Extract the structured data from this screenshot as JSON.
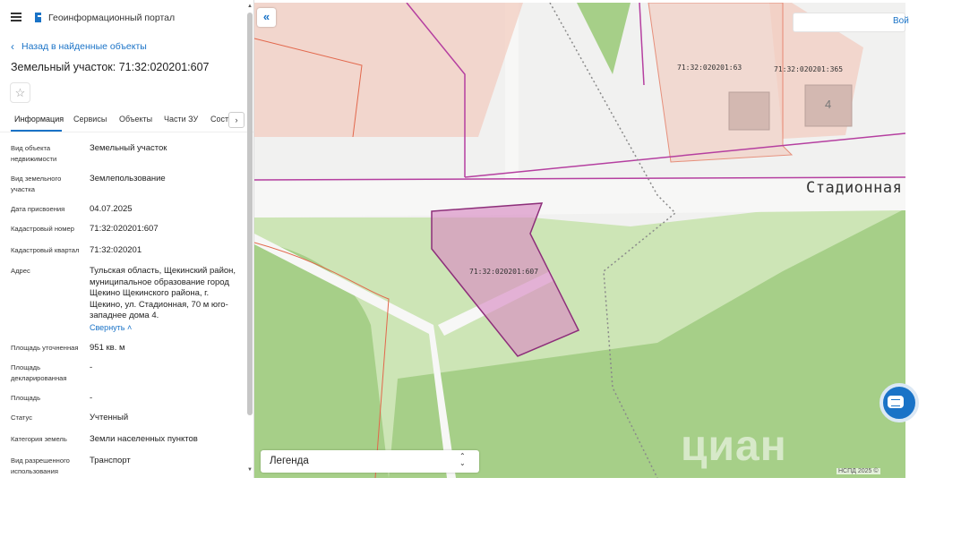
{
  "app": {
    "title": "Геоинформационный портал"
  },
  "nav": {
    "back_label": "Назад в найденные объекты"
  },
  "object": {
    "title": "Земельный участок: 71:32:020201:607"
  },
  "tabs": [
    {
      "label": "Информация"
    },
    {
      "label": "Сервисы"
    },
    {
      "label": "Объекты"
    },
    {
      "label": "Части ЗУ"
    },
    {
      "label": "Соста"
    }
  ],
  "properties": [
    {
      "label": "Вид объекта недвижимости",
      "value": "Земельный участок"
    },
    {
      "label": "Вид земельного участка",
      "value": "Землепользование"
    },
    {
      "label": "Дата присвоения",
      "value": "04.07.2025"
    },
    {
      "label": "Кадастровый номер",
      "value": "71:32:020201:607"
    },
    {
      "label": "Кадастровый квартал",
      "value": "71:32:020201"
    },
    {
      "label": "Адрес",
      "value": "Тульская область, Щекинский район, муниципальное образование город Щекино Щекинского района, г. Щекино, ул. Стадионная, 70 м юго-западнее дома 4."
    },
    {
      "label": "Площадь уточненная",
      "value": "951 кв. м"
    },
    {
      "label": "Площадь декларированная",
      "value": "-"
    },
    {
      "label": "Площадь",
      "value": "-"
    },
    {
      "label": "Статус",
      "value": "Учтенный"
    },
    {
      "label": "Категория земель",
      "value": "Земли населенных пунктов"
    },
    {
      "label": "Вид разрешенного использования",
      "value": "Транспорт"
    }
  ],
  "address_toggle": "Свернуть",
  "map": {
    "street_label": "Стадионная",
    "parcel_label": "71:32:020201:607",
    "parcel_63_label": "71:32:020201:63",
    "parcel_365_label": "71:32:020201:365",
    "house_number": "4",
    "search_label": "Вой",
    "legend_label": "Легенда",
    "copyright": "НСПД 2025 ©",
    "watermark": "циан"
  },
  "colors": {
    "accent": "#1a73c7",
    "parcel_fill": "#e3a6cf",
    "parcel_stroke": "#8d2f7a",
    "green_light": "#cfe6b8",
    "green_dark": "#a7d08a"
  }
}
